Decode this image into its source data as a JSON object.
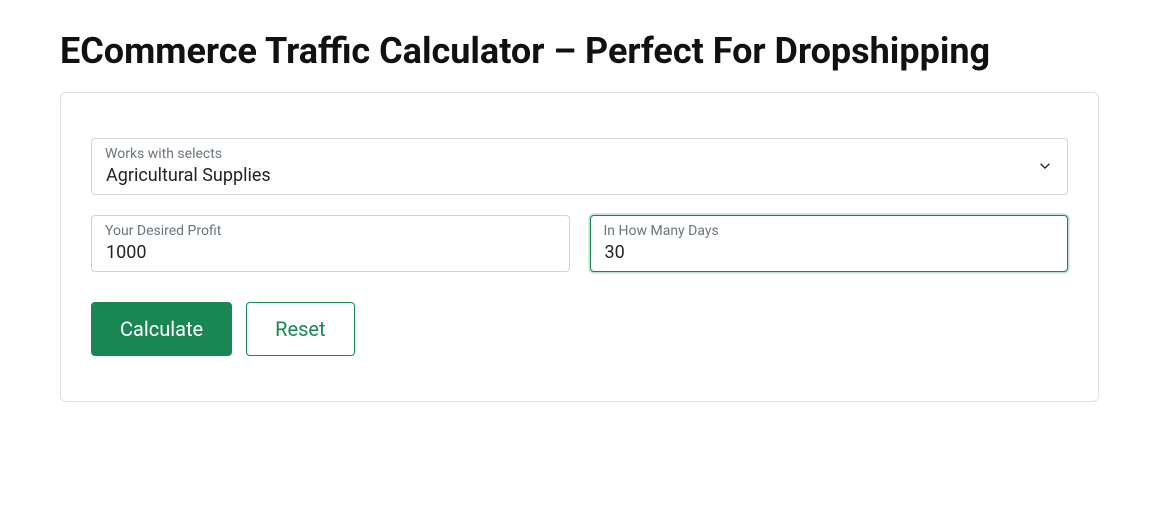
{
  "page": {
    "title": "ECommerce Traffic Calculator – Perfect For Dropshipping"
  },
  "form": {
    "select": {
      "label": "Works with selects",
      "value": "Agricultural Supplies"
    },
    "profit": {
      "label": "Your Desired Profit",
      "value": "1000"
    },
    "days": {
      "label": "In How Many Days",
      "value": "30"
    },
    "buttons": {
      "calculate": "Calculate",
      "reset": "Reset"
    }
  }
}
